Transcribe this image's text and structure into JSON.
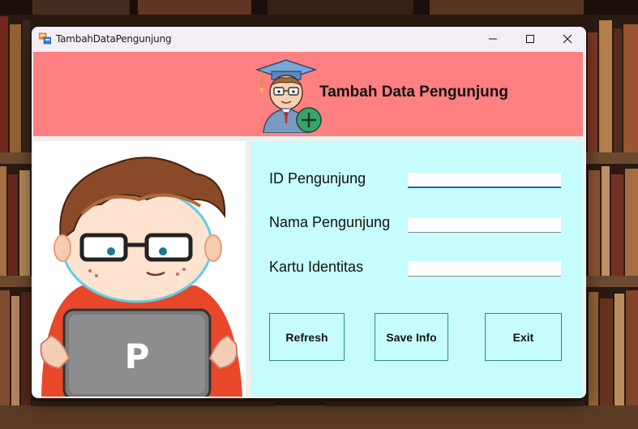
{
  "window": {
    "title": "TambahDataPengunjung"
  },
  "header": {
    "title": "Tambah Data Pengunjung",
    "icon": "graduate-add-icon"
  },
  "form": {
    "fields": [
      {
        "label": "ID Pengunjung",
        "value": "",
        "focused": true
      },
      {
        "label": "Nama Pengunjung",
        "value": ""
      },
      {
        "label": "Kartu Identitas",
        "value": ""
      }
    ]
  },
  "buttons": {
    "refresh": "Refresh",
    "save": "Save Info",
    "exit": "Exit"
  },
  "left_image": {
    "laptop_letter": "P"
  },
  "colors": {
    "header_bg": "#ff8080",
    "form_bg": "#c6fcfc",
    "button_border": "#2a8a8a"
  }
}
